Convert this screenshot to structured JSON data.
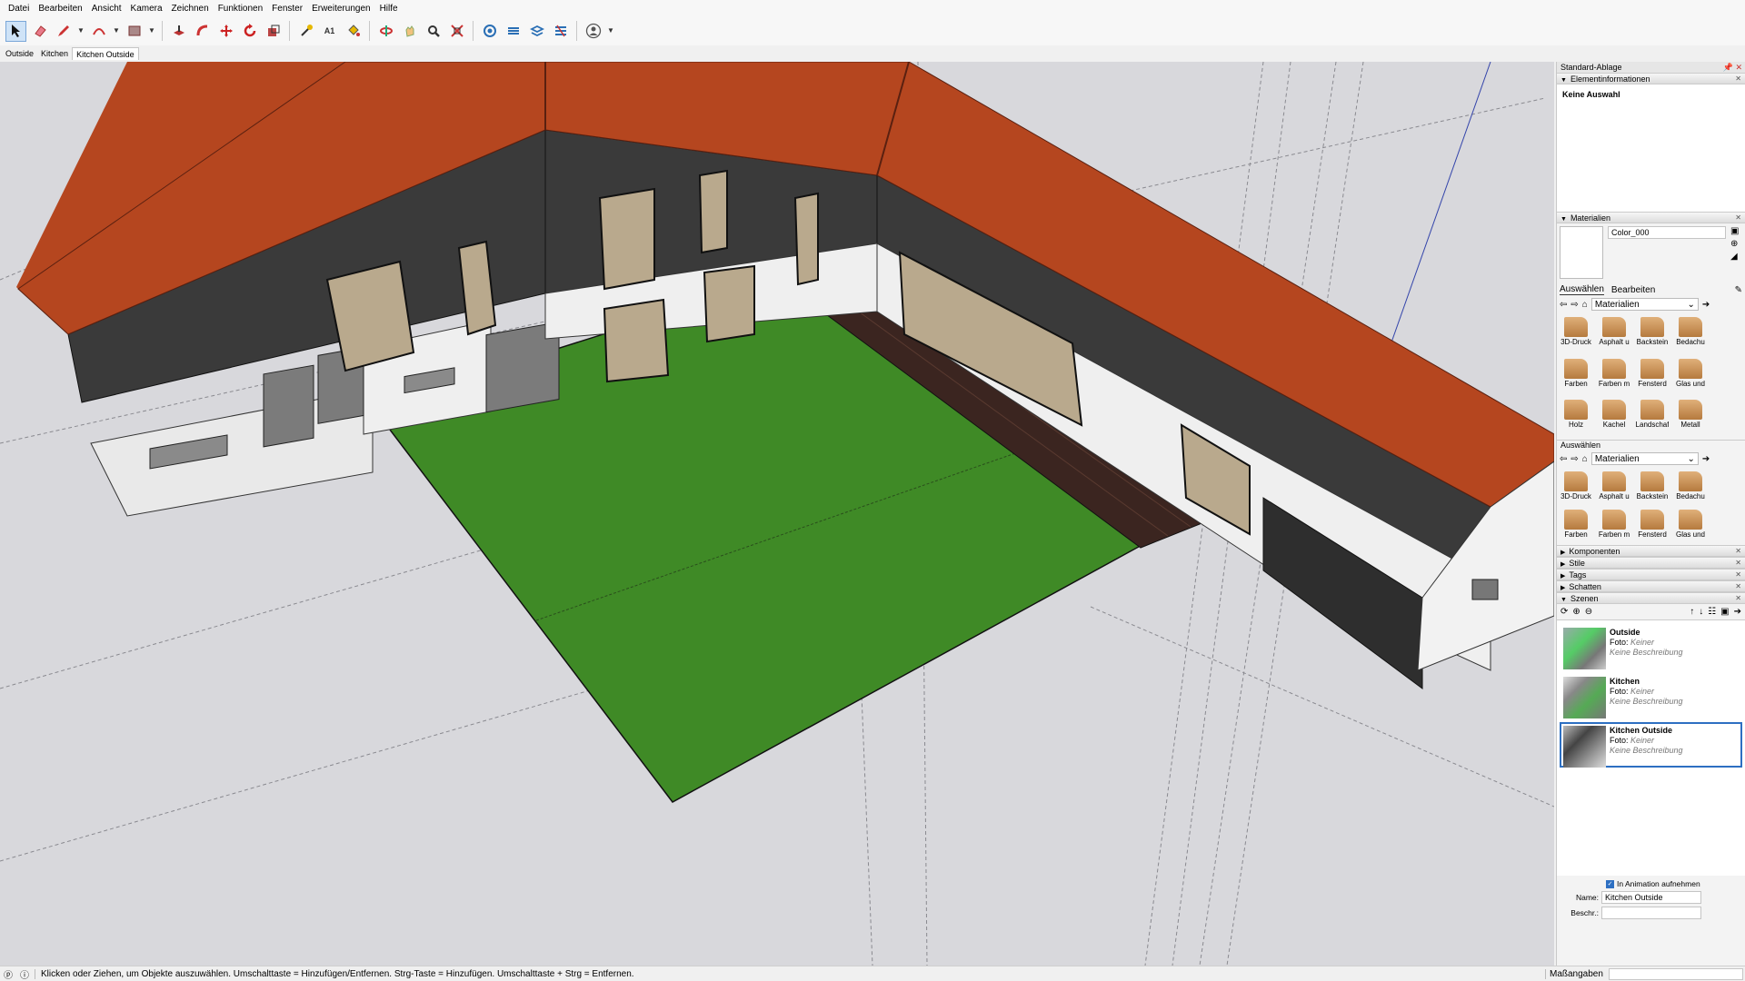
{
  "menu": [
    "Datei",
    "Bearbeiten",
    "Ansicht",
    "Kamera",
    "Zeichnen",
    "Funktionen",
    "Fenster",
    "Erweiterungen",
    "Hilfe"
  ],
  "scene_tabs": [
    "Outside",
    "Kitchen",
    "Kitchen Outside"
  ],
  "active_scene_tab": "Kitchen Outside",
  "panel": {
    "tray_title": "Standard-Ablage",
    "entity_info": {
      "header": "Elementinformationen",
      "selection": "Keine Auswahl"
    },
    "materials": {
      "header": "Materialien",
      "current_name": "Color_000",
      "tab_select": "Auswählen",
      "tab_edit": "Bearbeiten",
      "collection": "Materialien",
      "tiles": [
        "3D-Druck",
        "Asphalt u",
        "Backstein",
        "Bedachu",
        "Farben",
        "Farben m",
        "Fensterd",
        "Glas und",
        "Holz",
        "Kachel",
        "Landschaf",
        "Metall"
      ],
      "secondary_header": "Auswählen",
      "secondary_collection": "Materialien",
      "secondary_tiles": [
        "3D-Druck",
        "Asphalt u",
        "Backstein",
        "Bedachu",
        "Farben",
        "Farben m",
        "Fensterd",
        "Glas und"
      ]
    },
    "collapsed_sections": [
      "Komponenten",
      "Stile",
      "Tags",
      "Schatten"
    ],
    "scenes": {
      "header": "Szenen",
      "items": [
        {
          "name": "Outside",
          "photo_label": "Foto:",
          "photo_value": "Keiner",
          "description": "Keine Beschreibung"
        },
        {
          "name": "Kitchen",
          "photo_label": "Foto:",
          "photo_value": "Keiner",
          "description": "Keine Beschreibung"
        },
        {
          "name": "Kitchen Outside",
          "photo_label": "Foto:",
          "photo_value": "Keiner",
          "description": "Keine Beschreibung"
        }
      ],
      "selected": "Kitchen Outside",
      "include_animation_label": "In Animation aufnehmen",
      "include_animation_checked": true,
      "name_label": "Name:",
      "name_value": "Kitchen Outside",
      "desc_label": "Beschr.:",
      "desc_value": ""
    }
  },
  "status": {
    "hint": "Klicken oder Ziehen, um Objekte auszuwählen. Umschalttaste = Hinzufügen/Entfernen. Strg-Taste = Hinzufügen. Umschalttaste + Strg = Entfernen.",
    "measurements_label": "Maßangaben"
  },
  "colors": {
    "accent": "#2d6fc2",
    "roof": "#b5461f",
    "wall_dark": "#3a3a3a",
    "lawn": "#3f8a26",
    "deck": "#3b2520"
  }
}
